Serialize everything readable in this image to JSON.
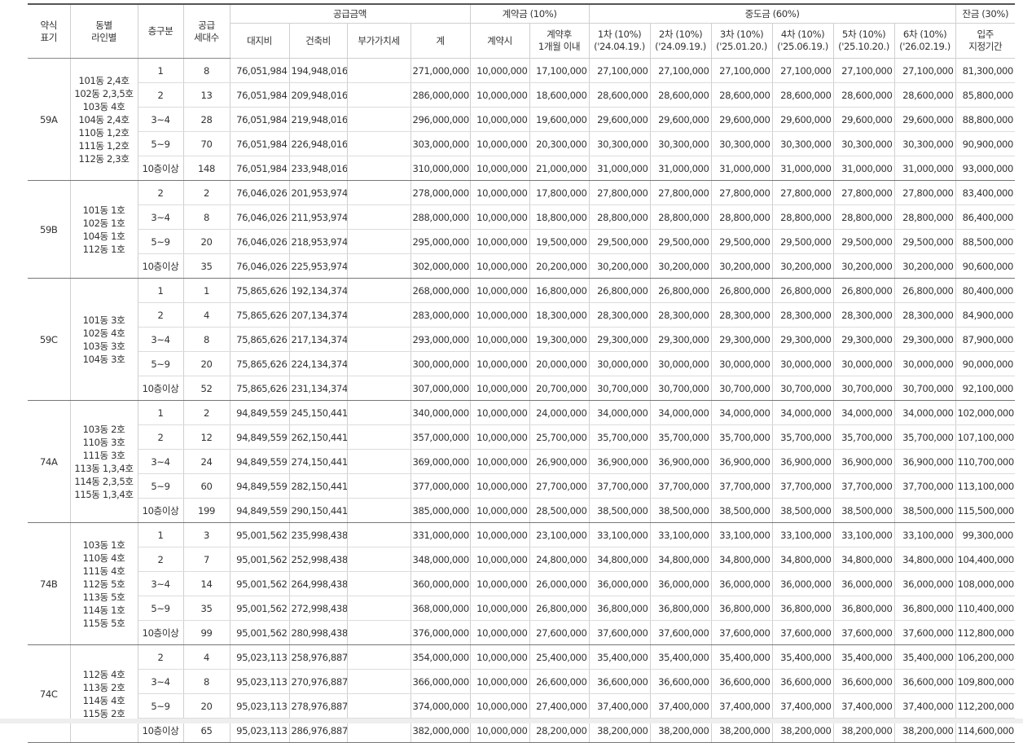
{
  "headers": {
    "type": "약식\n표기",
    "lines": "동별\n라인별",
    "floor": "층구분",
    "units": "공급\n세대수",
    "supply": "공급금액",
    "land": "대지비",
    "building": "건축비",
    "vat": "부가가치세",
    "total": "계",
    "deposit": "계약금 (10%)",
    "deposit_at": "계약시",
    "deposit_after": "계약후\n1개월 이내",
    "interim": "중도금 (60%)",
    "interim_cols": [
      {
        "label": "1차 (10%)",
        "date": "('24.04.19.)"
      },
      {
        "label": "2차 (10%)",
        "date": "('24.09.19.)"
      },
      {
        "label": "3차 (10%)",
        "date": "('25.01.20.)"
      },
      {
        "label": "4차 (10%)",
        "date": "('25.06.19.)"
      },
      {
        "label": "5차 (10%)",
        "date": "('25.10.20.)"
      },
      {
        "label": "6차 (10%)",
        "date": "('26.02.19.)"
      }
    ],
    "balance": "잔금 (30%)",
    "balance_sub": "입주\n지정기간"
  },
  "groups": [
    {
      "type": "59A",
      "lines": [
        "101동 2,4호",
        "102동 2,3,5호",
        "103동 4호",
        "104동 2,4호",
        "110동 1,2호",
        "111동 1,2호",
        "112동 2,3호"
      ],
      "rows": [
        {
          "floor": "1",
          "units": "8",
          "land": "76,051,984",
          "building": "194,948,016",
          "vat": "",
          "total": "271,000,000",
          "dep1": "10,000,000",
          "dep2": "17,100,000",
          "interim": "27,100,000",
          "balance": "81,300,000"
        },
        {
          "floor": "2",
          "units": "13",
          "land": "76,051,984",
          "building": "209,948,016",
          "vat": "",
          "total": "286,000,000",
          "dep1": "10,000,000",
          "dep2": "18,600,000",
          "interim": "28,600,000",
          "balance": "85,800,000"
        },
        {
          "floor": "3~4",
          "units": "28",
          "land": "76,051,984",
          "building": "219,948,016",
          "vat": "",
          "total": "296,000,000",
          "dep1": "10,000,000",
          "dep2": "19,600,000",
          "interim": "29,600,000",
          "balance": "88,800,000"
        },
        {
          "floor": "5~9",
          "units": "70",
          "land": "76,051,984",
          "building": "226,948,016",
          "vat": "",
          "total": "303,000,000",
          "dep1": "10,000,000",
          "dep2": "20,300,000",
          "interim": "30,300,000",
          "balance": "90,900,000"
        },
        {
          "floor": "10층이상",
          "units": "148",
          "land": "76,051,984",
          "building": "233,948,016",
          "vat": "",
          "total": "310,000,000",
          "dep1": "10,000,000",
          "dep2": "21,000,000",
          "interim": "31,000,000",
          "balance": "93,000,000"
        }
      ]
    },
    {
      "type": "59B",
      "lines": [
        "101동 1호",
        "102동 1호",
        "104동 1호",
        "112동 1호"
      ],
      "rows": [
        {
          "floor": "2",
          "units": "2",
          "land": "76,046,026",
          "building": "201,953,974",
          "vat": "",
          "total": "278,000,000",
          "dep1": "10,000,000",
          "dep2": "17,800,000",
          "interim": "27,800,000",
          "balance": "83,400,000"
        },
        {
          "floor": "3~4",
          "units": "8",
          "land": "76,046,026",
          "building": "211,953,974",
          "vat": "",
          "total": "288,000,000",
          "dep1": "10,000,000",
          "dep2": "18,800,000",
          "interim": "28,800,000",
          "balance": "86,400,000"
        },
        {
          "floor": "5~9",
          "units": "20",
          "land": "76,046,026",
          "building": "218,953,974",
          "vat": "",
          "total": "295,000,000",
          "dep1": "10,000,000",
          "dep2": "19,500,000",
          "interim": "29,500,000",
          "balance": "88,500,000"
        },
        {
          "floor": "10층이상",
          "units": "35",
          "land": "76,046,026",
          "building": "225,953,974",
          "vat": "",
          "total": "302,000,000",
          "dep1": "10,000,000",
          "dep2": "20,200,000",
          "interim": "30,200,000",
          "balance": "90,600,000"
        }
      ]
    },
    {
      "type": "59C",
      "lines": [
        "101동 3호",
        "102동 4호",
        "103동 3호",
        "104동 3호"
      ],
      "rows": [
        {
          "floor": "1",
          "units": "1",
          "land": "75,865,626",
          "building": "192,134,374",
          "vat": "",
          "total": "268,000,000",
          "dep1": "10,000,000",
          "dep2": "16,800,000",
          "interim": "26,800,000",
          "balance": "80,400,000"
        },
        {
          "floor": "2",
          "units": "4",
          "land": "75,865,626",
          "building": "207,134,374",
          "vat": "",
          "total": "283,000,000",
          "dep1": "10,000,000",
          "dep2": "18,300,000",
          "interim": "28,300,000",
          "balance": "84,900,000"
        },
        {
          "floor": "3~4",
          "units": "8",
          "land": "75,865,626",
          "building": "217,134,374",
          "vat": "",
          "total": "293,000,000",
          "dep1": "10,000,000",
          "dep2": "19,300,000",
          "interim": "29,300,000",
          "balance": "87,900,000"
        },
        {
          "floor": "5~9",
          "units": "20",
          "land": "75,865,626",
          "building": "224,134,374",
          "vat": "",
          "total": "300,000,000",
          "dep1": "10,000,000",
          "dep2": "20,000,000",
          "interim": "30,000,000",
          "balance": "90,000,000"
        },
        {
          "floor": "10층이상",
          "units": "52",
          "land": "75,865,626",
          "building": "231,134,374",
          "vat": "",
          "total": "307,000,000",
          "dep1": "10,000,000",
          "dep2": "20,700,000",
          "interim": "30,700,000",
          "balance": "92,100,000"
        }
      ]
    },
    {
      "type": "74A",
      "lines": [
        "103동 2호",
        "110동 3호",
        "111동 3호",
        "113동 1,3,4호",
        "114동 2,3,5호",
        "115동 1,3,4호"
      ],
      "rows": [
        {
          "floor": "1",
          "units": "2",
          "land": "94,849,559",
          "building": "245,150,441",
          "vat": "",
          "total": "340,000,000",
          "dep1": "10,000,000",
          "dep2": "24,000,000",
          "interim": "34,000,000",
          "balance": "102,000,000"
        },
        {
          "floor": "2",
          "units": "12",
          "land": "94,849,559",
          "building": "262,150,441",
          "vat": "",
          "total": "357,000,000",
          "dep1": "10,000,000",
          "dep2": "25,700,000",
          "interim": "35,700,000",
          "balance": "107,100,000"
        },
        {
          "floor": "3~4",
          "units": "24",
          "land": "94,849,559",
          "building": "274,150,441",
          "vat": "",
          "total": "369,000,000",
          "dep1": "10,000,000",
          "dep2": "26,900,000",
          "interim": "36,900,000",
          "balance": "110,700,000"
        },
        {
          "floor": "5~9",
          "units": "60",
          "land": "94,849,559",
          "building": "282,150,441",
          "vat": "",
          "total": "377,000,000",
          "dep1": "10,000,000",
          "dep2": "27,700,000",
          "interim": "37,700,000",
          "balance": "113,100,000"
        },
        {
          "floor": "10층이상",
          "units": "199",
          "land": "94,849,559",
          "building": "290,150,441",
          "vat": "",
          "total": "385,000,000",
          "dep1": "10,000,000",
          "dep2": "28,500,000",
          "interim": "38,500,000",
          "balance": "115,500,000"
        }
      ]
    },
    {
      "type": "74B",
      "lines": [
        "103동 1호",
        "110동 4호",
        "111동 4호",
        "112동 5호",
        "113동 5호",
        "114동 1호",
        "115동 5호"
      ],
      "rows": [
        {
          "floor": "1",
          "units": "3",
          "land": "95,001,562",
          "building": "235,998,438",
          "vat": "",
          "total": "331,000,000",
          "dep1": "10,000,000",
          "dep2": "23,100,000",
          "interim": "33,100,000",
          "balance": "99,300,000"
        },
        {
          "floor": "2",
          "units": "7",
          "land": "95,001,562",
          "building": "252,998,438",
          "vat": "",
          "total": "348,000,000",
          "dep1": "10,000,000",
          "dep2": "24,800,000",
          "interim": "34,800,000",
          "balance": "104,400,000"
        },
        {
          "floor": "3~4",
          "units": "14",
          "land": "95,001,562",
          "building": "264,998,438",
          "vat": "",
          "total": "360,000,000",
          "dep1": "10,000,000",
          "dep2": "26,000,000",
          "interim": "36,000,000",
          "balance": "108,000,000"
        },
        {
          "floor": "5~9",
          "units": "35",
          "land": "95,001,562",
          "building": "272,998,438",
          "vat": "",
          "total": "368,000,000",
          "dep1": "10,000,000",
          "dep2": "26,800,000",
          "interim": "36,800,000",
          "balance": "110,400,000"
        },
        {
          "floor": "10층이상",
          "units": "99",
          "land": "95,001,562",
          "building": "280,998,438",
          "vat": "",
          "total": "376,000,000",
          "dep1": "10,000,000",
          "dep2": "27,600,000",
          "interim": "37,600,000",
          "balance": "112,800,000"
        }
      ]
    },
    {
      "type": "74C",
      "lines": [
        "112동 4호",
        "113동 2호",
        "114동 4호",
        "115동 2호"
      ],
      "rows": [
        {
          "floor": "2",
          "units": "4",
          "land": "95,023,113",
          "building": "258,976,887",
          "vat": "",
          "total": "354,000,000",
          "dep1": "10,000,000",
          "dep2": "25,400,000",
          "interim": "35,400,000",
          "balance": "106,200,000"
        },
        {
          "floor": "3~4",
          "units": "8",
          "land": "95,023,113",
          "building": "270,976,887",
          "vat": "",
          "total": "366,000,000",
          "dep1": "10,000,000",
          "dep2": "26,600,000",
          "interim": "36,600,000",
          "balance": "109,800,000"
        },
        {
          "floor": "5~9",
          "units": "20",
          "land": "95,023,113",
          "building": "278,976,887",
          "vat": "",
          "total": "374,000,000",
          "dep1": "10,000,000",
          "dep2": "27,400,000",
          "interim": "37,400,000",
          "balance": "112,200,000"
        },
        {
          "floor": "10층이상",
          "units": "65",
          "land": "95,023,113",
          "building": "286,976,887",
          "vat": "",
          "total": "382,000,000",
          "dep1": "10,000,000",
          "dep2": "28,200,000",
          "interim": "38,200,000",
          "balance": "114,600,000"
        }
      ]
    }
  ]
}
